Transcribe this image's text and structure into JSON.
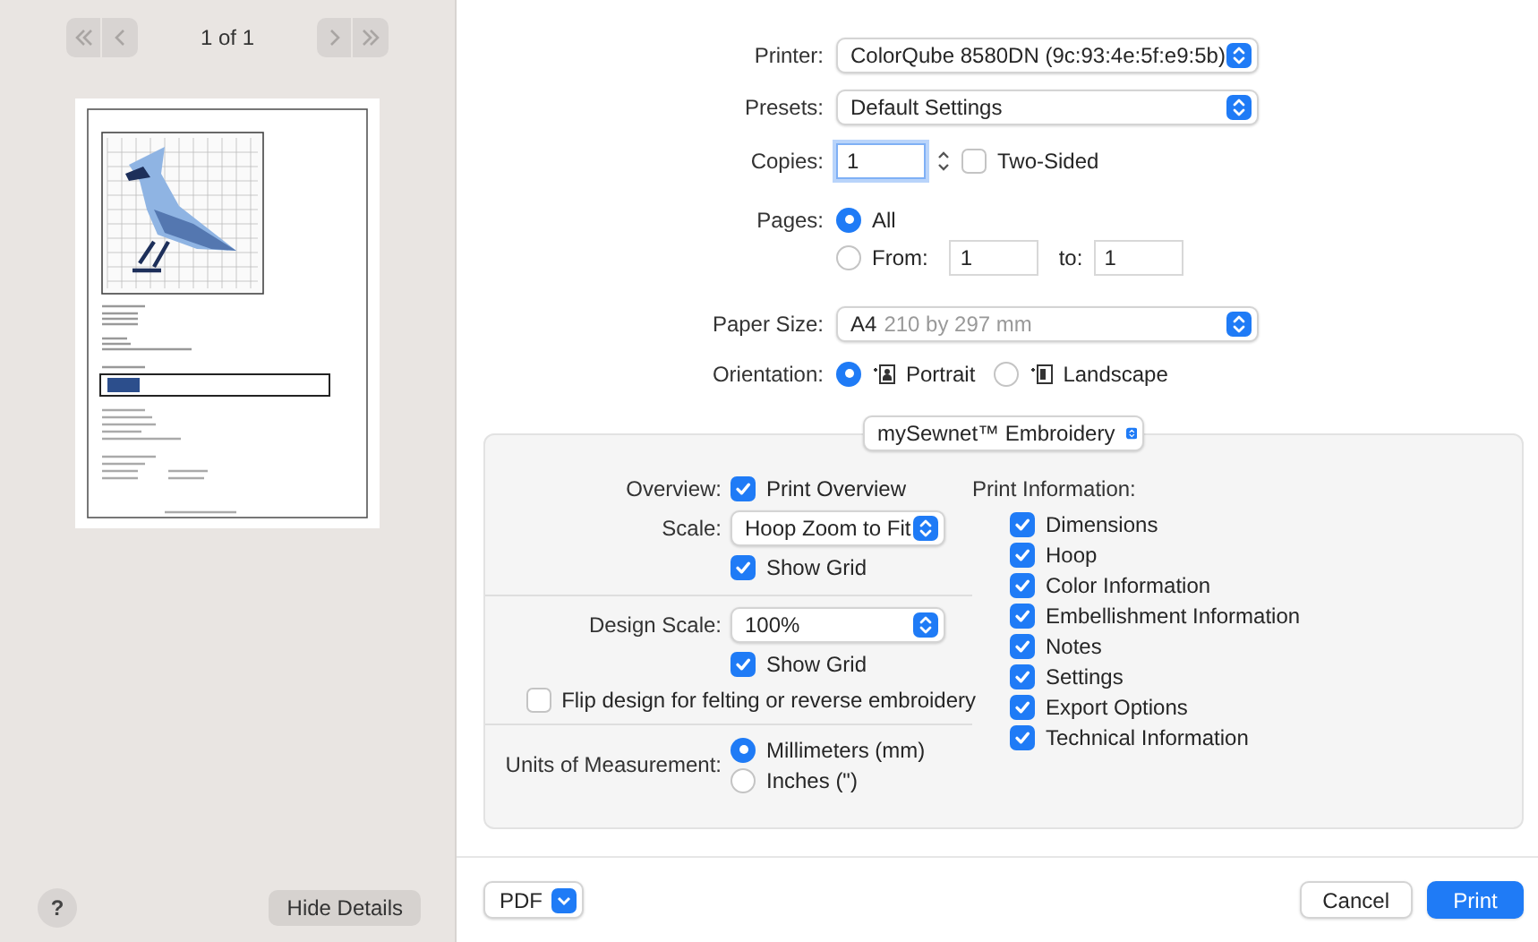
{
  "sidebar": {
    "page_indicator": "1 of 1",
    "help": "?",
    "hide_details": "Hide Details"
  },
  "printer": {
    "label": "Printer:",
    "value": "ColorQube 8580DN (9c:93:4e:5f:e9:5b)"
  },
  "presets": {
    "label": "Presets:",
    "value": "Default Settings"
  },
  "copies": {
    "label": "Copies:",
    "value": "1",
    "two_sided": {
      "label": "Two-Sided",
      "checked": false
    }
  },
  "pages": {
    "label": "Pages:",
    "options": [
      {
        "label": "All",
        "selected": true
      },
      {
        "label": "From:",
        "selected": false
      }
    ],
    "from": "1",
    "to_label": "to:",
    "to": "1"
  },
  "paper_size": {
    "label": "Paper Size:",
    "value": "A4",
    "detail": "210 by 297 mm"
  },
  "orientation": {
    "label": "Orientation:",
    "options": [
      {
        "label": "Portrait",
        "selected": true
      },
      {
        "label": "Landscape",
        "selected": false
      }
    ]
  },
  "panel": {
    "menu": "mySewnet™ Embroidery",
    "overview": {
      "label": "Overview:",
      "option": {
        "label": "Print Overview",
        "checked": true
      }
    },
    "scale": {
      "label": "Scale:",
      "value": "Hoop Zoom to Fit"
    },
    "overview_grid": {
      "label": "Show Grid",
      "checked": true
    },
    "design_scale": {
      "label": "Design Scale:",
      "value": "100%"
    },
    "design_grid": {
      "label": "Show Grid",
      "checked": true
    },
    "flip": {
      "label": "Flip design for felting or reverse embroidery",
      "checked": false
    },
    "units": {
      "label": "Units of Measurement:",
      "options": [
        {
          "label": "Millimeters (mm)",
          "selected": true
        },
        {
          "label": "Inches (\")",
          "selected": false
        }
      ]
    },
    "print_information": {
      "label": "Print Information:",
      "items": [
        {
          "label": "Dimensions",
          "checked": true
        },
        {
          "label": "Hoop",
          "checked": true
        },
        {
          "label": "Color Information",
          "checked": true
        },
        {
          "label": "Embellishment Information",
          "checked": true
        },
        {
          "label": "Notes",
          "checked": true
        },
        {
          "label": "Settings",
          "checked": true
        },
        {
          "label": "Export Options",
          "checked": true
        },
        {
          "label": "Technical Information",
          "checked": true
        }
      ]
    }
  },
  "footer": {
    "pdf": "PDF",
    "cancel": "Cancel",
    "print": "Print"
  }
}
